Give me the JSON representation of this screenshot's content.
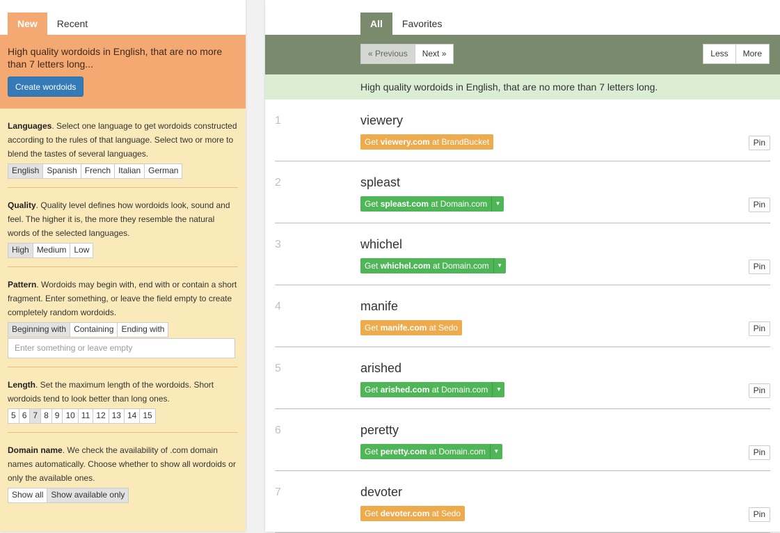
{
  "left": {
    "tabs": [
      {
        "label": "New"
      },
      {
        "label": "Recent"
      }
    ],
    "intro": "High quality wordoids in English, that are no more than 7 letters long...",
    "create_button": "Create wordoids",
    "languages": {
      "title": "Languages",
      "text": ". Select one language to get wordoids constructed according to the rules of that language. Select two or more to blend the tastes of several languages.",
      "options": [
        "English",
        "Spanish",
        "French",
        "Italian",
        "German"
      ],
      "selected": "English"
    },
    "quality": {
      "title": "Quality",
      "text": ". Quality level defines how wordoids look, sound and feel. The higher it is, the more they resemble the natural words of the selected languages.",
      "options": [
        "High",
        "Medium",
        "Low"
      ],
      "selected": "High"
    },
    "pattern": {
      "title": "Pattern",
      "text": ". Wordoids may begin with, end with or contain a short fragment. Enter something, or leave the field empty to create completely random wordoids.",
      "options": [
        "Beginning with",
        "Containing",
        "Ending with"
      ],
      "selected": "Beginning with",
      "placeholder": "Enter something or leave empty"
    },
    "length": {
      "title": "Length",
      "text": ". Set the maximum length of the wordoids. Short wordoids tend to look better than long ones.",
      "options": [
        "5",
        "6",
        "7",
        "8",
        "9",
        "10",
        "11",
        "12",
        "13",
        "14",
        "15"
      ],
      "selected": "7"
    },
    "domain": {
      "title": "Domain name",
      "text": ". We check the availability of .com domain names automatically. Choose whether to show all wordoids or only the available ones.",
      "options": [
        "Show all",
        "Show available only"
      ],
      "selected": "Show available only"
    }
  },
  "right": {
    "tabs": [
      {
        "label": "All"
      },
      {
        "label": "Favorites"
      }
    ],
    "pager": {
      "previous": "« Previous",
      "next": "Next »"
    },
    "size": {
      "less": "Less",
      "more": "More"
    },
    "note": "High quality wordoids in English, that are no more than 7 letters long.",
    "rows": [
      {
        "num": "1",
        "word": "viewery",
        "offer_prefix": "Get ",
        "domain": "viewery.com",
        "offer_suffix": " at BrandBucket",
        "style": "orange",
        "pin": "Pin"
      },
      {
        "num": "2",
        "word": "spleast",
        "offer_prefix": "Get ",
        "domain": "spleast.com",
        "offer_suffix": " at Domain.com",
        "style": "green",
        "pin": "Pin"
      },
      {
        "num": "3",
        "word": "whichel",
        "offer_prefix": "Get ",
        "domain": "whichel.com",
        "offer_suffix": " at Domain.com",
        "style": "green",
        "pin": "Pin"
      },
      {
        "num": "4",
        "word": "manife",
        "offer_prefix": "Get ",
        "domain": "manife.com",
        "offer_suffix": " at Sedo",
        "style": "orange",
        "pin": "Pin"
      },
      {
        "num": "5",
        "word": "arished",
        "offer_prefix": "Get ",
        "domain": "arished.com",
        "offer_suffix": " at Domain.com",
        "style": "green",
        "pin": "Pin"
      },
      {
        "num": "6",
        "word": "peretty",
        "offer_prefix": "Get ",
        "domain": "peretty.com",
        "offer_suffix": " at Domain.com",
        "style": "green",
        "pin": "Pin"
      },
      {
        "num": "7",
        "word": "devoter",
        "offer_prefix": "Get ",
        "domain": "devoter.com",
        "offer_suffix": " at Sedo",
        "style": "orange",
        "pin": "Pin"
      }
    ]
  },
  "colors": {
    "left_accent": "#f4a872",
    "left_bg": "#fbeab9",
    "right_header": "#7a8a6c",
    "note_bg": "#dbeed3",
    "offer_orange": "#eeab4d",
    "offer_green": "#4fb657",
    "primary_button": "#337ab7"
  }
}
